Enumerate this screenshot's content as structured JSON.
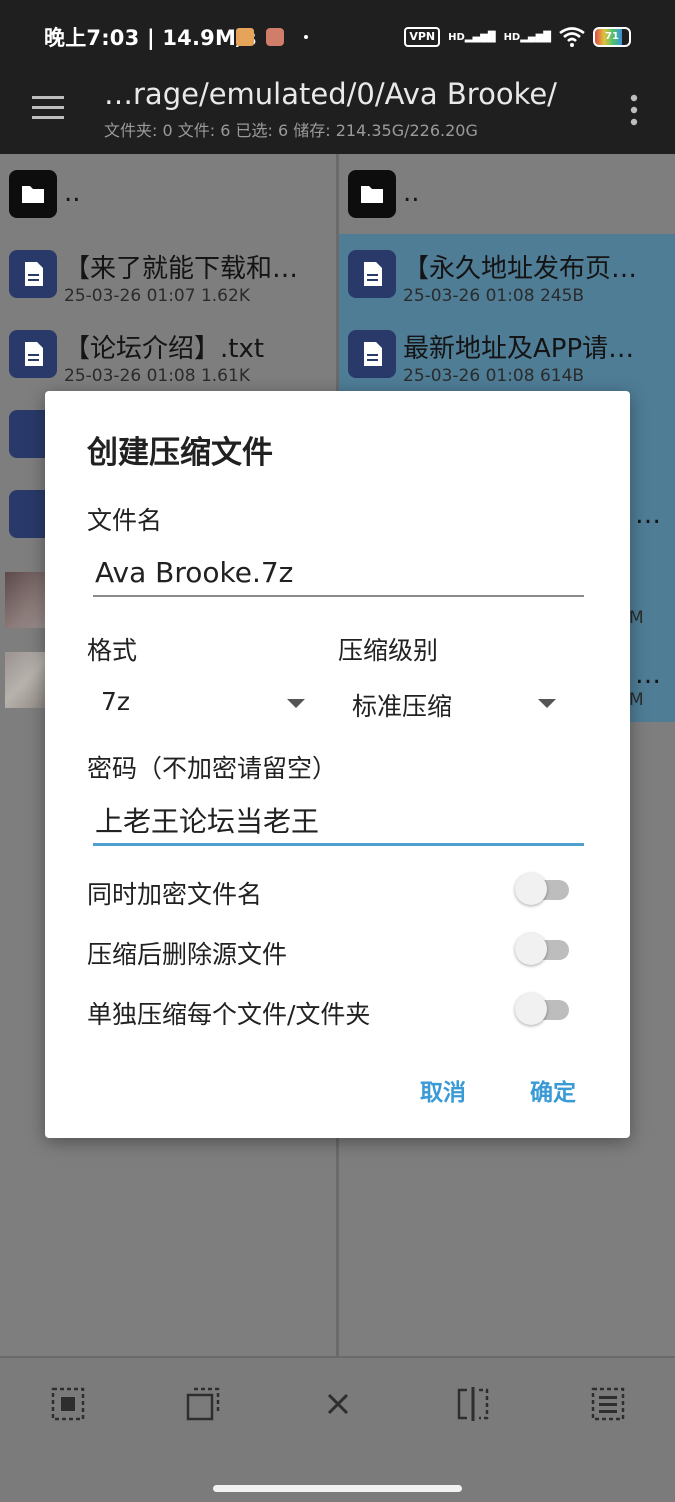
{
  "status_bar": {
    "time_speed": "晚上7:03 | 14.9M/s",
    "vpn": "VPN",
    "signal1": "HD",
    "signal2": "HD",
    "battery": "71"
  },
  "toolbar": {
    "path": "…rage/emulated/0/Ava Brooke/",
    "info": "文件夹: 0  文件: 6  已选: 6  储存: 214.35G/226.20G"
  },
  "left_panel": {
    "parent": "..",
    "items": [
      {
        "name": "【来了就能下载和…",
        "meta": "25-03-26 01:07 1.62K"
      },
      {
        "name": "【论坛介绍】.txt",
        "meta": "25-03-26 01:08 1.61K"
      }
    ]
  },
  "right_panel": {
    "parent": "..",
    "items": [
      {
        "name": "【永久地址发布页…",
        "meta": "25-03-26 01:08 245B"
      },
      {
        "name": "最新地址及APP请…",
        "meta": "25-03-26 01:08 614B"
      }
    ],
    "partial": [
      "…",
      "M",
      "…",
      "M"
    ]
  },
  "dialog": {
    "title": "创建压缩文件",
    "filename_label": "文件名",
    "filename_value": "Ava Brooke.7z",
    "format_label": "格式",
    "format_value": "7z",
    "level_label": "压缩级别",
    "level_value": "标准压缩",
    "password_label": "密码（不加密请留空）",
    "password_value": "上老王论坛当老王",
    "options": [
      {
        "label": "同时加密文件名",
        "on": false
      },
      {
        "label": "压缩后删除源文件",
        "on": false
      },
      {
        "label": "单独压缩每个文件/文件夹",
        "on": false
      }
    ],
    "cancel": "取消",
    "confirm": "确定"
  },
  "colors": {
    "accent": "#3a9ad6",
    "selected_row": "#4f7d96",
    "toolbar": "#1f1f1f",
    "scrim": "#7e7e7e"
  }
}
